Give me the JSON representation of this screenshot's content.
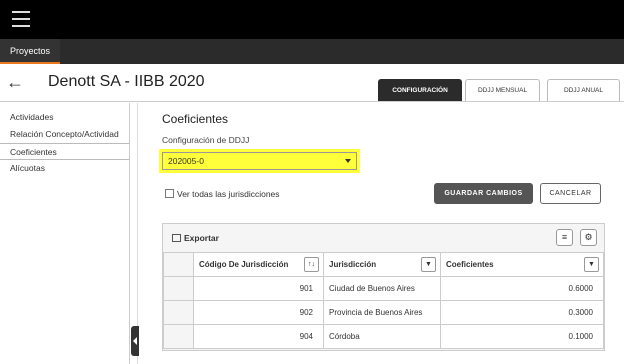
{
  "nav": {
    "active_tab": "Proyectos"
  },
  "header": {
    "title": "Denott SA - IIBB 2020"
  },
  "tabs": [
    {
      "label": "CONFIGURACIÓN",
      "active": true
    },
    {
      "label": "DDJJ MENSUAL",
      "active": false
    },
    {
      "label": "DDJJ ANUAL",
      "active": false
    }
  ],
  "sidebar": {
    "items": [
      {
        "label": "Actividades"
      },
      {
        "label": "Relación Concepto/Actividad"
      },
      {
        "label": "Coeficientes"
      },
      {
        "label": "Alícuotas"
      }
    ]
  },
  "main": {
    "title": "Coeficientes",
    "config_label": "Configuración de DDJJ",
    "select_value": "202005-0",
    "show_all_label": "Ver todas las jurisdicciones",
    "save_label": "GUARDAR CAMBIOS",
    "cancel_label": "CANCELAR",
    "highlight_color": "#ffff3a"
  },
  "grid": {
    "export_label": "Exportar",
    "columns": [
      "Código De Jurisdicción",
      "Jurisdicción",
      "Coeficientes"
    ],
    "rows": [
      [
        "901",
        "Ciudad de Buenos Aires",
        "0.6000"
      ],
      [
        "902",
        "Provincia de Buenos Aires",
        "0.3000"
      ],
      [
        "904",
        "Córdoba",
        "0.1000"
      ]
    ]
  }
}
